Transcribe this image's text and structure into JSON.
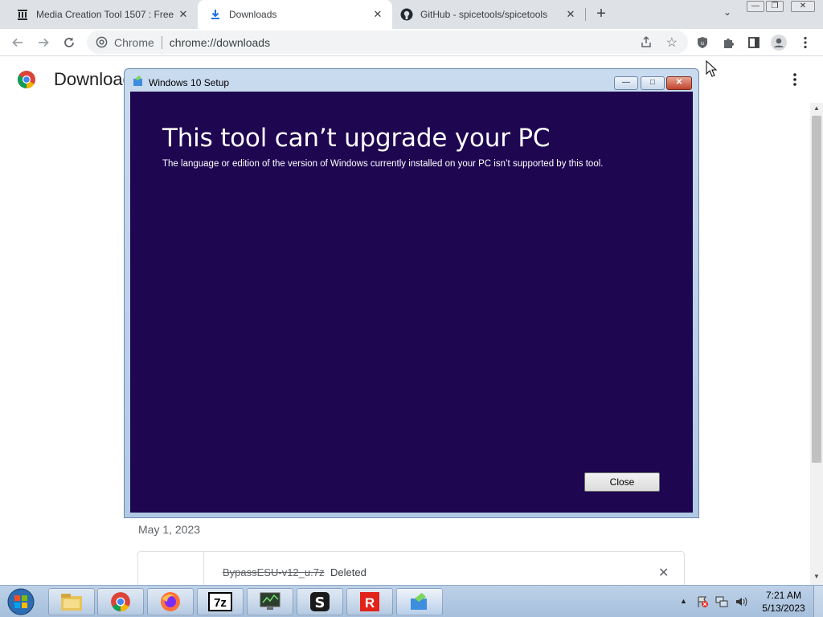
{
  "browser": {
    "tabs": [
      {
        "label": "Media Creation Tool 1507 : Free"
      },
      {
        "label": "Downloads"
      },
      {
        "label": "GitHub - spicetools/spicetools"
      }
    ],
    "omnibox": {
      "scheme_label": "Chrome",
      "url": "chrome://downloads"
    },
    "new_tab_symbol": "+"
  },
  "page": {
    "title": "Downloads",
    "date_heading": "May 1, 2023",
    "download": {
      "file_name": "BypassESU-v12_u.7z",
      "status": "Deleted"
    }
  },
  "dialog": {
    "title": "Windows 10 Setup",
    "heading": "This tool can’t upgrade your PC",
    "message": "The language or edition of the version of Windows currently installed on your PC isn’t supported by this tool.",
    "close_button": "Close",
    "background_color": "#1e0651"
  },
  "taskbar": {
    "pinned": [
      "explorer-icon",
      "chrome-icon",
      "firefox-icon",
      "7zip-icon",
      "monitor-app-icon",
      "spicetools-icon",
      "roblox-icon",
      "media-creation-tool-icon"
    ],
    "clock": {
      "time": "7:21 AM",
      "date": "5/13/2023"
    }
  },
  "colors": {
    "chrome_tab_strip": "#dee1e6",
    "taskbar": "#a6bfdc",
    "accent": "#1a73e8"
  }
}
